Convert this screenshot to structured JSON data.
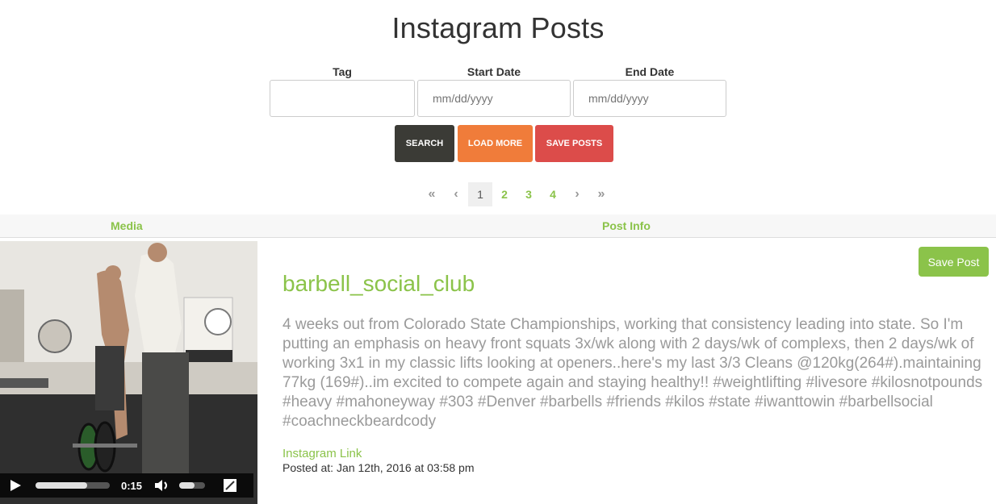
{
  "page": {
    "title": "Instagram Posts"
  },
  "form": {
    "tag": {
      "label": "Tag",
      "value": "",
      "placeholder": ""
    },
    "start_date": {
      "label": "Start Date",
      "placeholder": "mm/dd/yyyy"
    },
    "end_date": {
      "label": "End Date",
      "placeholder": "mm/dd/yyyy"
    }
  },
  "buttons": {
    "search": "SEARCH",
    "load_more": "LOAD MORE",
    "save_posts": "SAVE POSTS"
  },
  "pagination": {
    "first": "«",
    "prev": "‹",
    "next": "›",
    "last": "»",
    "pages": [
      "1",
      "2",
      "3",
      "4"
    ],
    "current": "1"
  },
  "table": {
    "headers": {
      "media": "Media",
      "post_info": "Post Info"
    }
  },
  "post": {
    "save_label": "Save Post",
    "username": "barbell_social_club",
    "caption": "4 weeks out from Colorado State Championships, working that consistency leading into state. So I'm putting an emphasis on heavy front squats 3x/wk along with 2 days/wk of complexs, then 2 days/wk of working 3x1 in my classic lifts looking at openers..here's my last 3/3 Cleans @120kg(264#).maintaining 77kg (169#)..im excited to compete again and staying healthy!! #weightlifting #livesore #kilosnotpounds #heavy #mahoneyway #303 #Denver #barbells #friends #kilos #state #iwanttowin #barbellsocial #coachneckbeardcody",
    "link_label": "Instagram Link",
    "posted_label": "Posted at:",
    "posted_value": "Jan 12th, 2016 at 03:58 pm",
    "video": {
      "time": "0:15",
      "progress": 0.7,
      "volume": 0.6,
      "icons": [
        "play-icon",
        "volume-icon",
        "fullscreen-icon"
      ]
    }
  },
  "colors": {
    "accent": "#8bc34a",
    "search": "#3b3b36",
    "load_more": "#f07c3a",
    "save_posts": "#dc4c4a"
  }
}
